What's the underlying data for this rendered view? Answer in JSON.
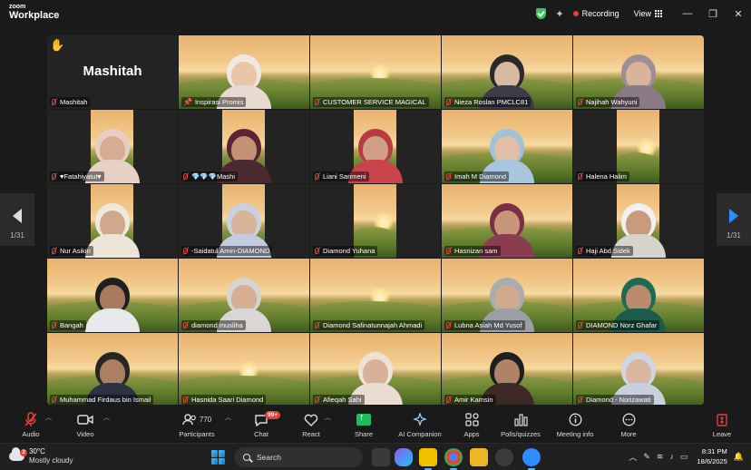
{
  "window": {
    "logo_line1": "zoom",
    "logo_line2": "Workplace",
    "recording": "Recording",
    "view": "View"
  },
  "nav": {
    "left_page": "1/31",
    "right_page": "1/31"
  },
  "tiles": [
    {
      "name": "Mashitah",
      "type": "avatar",
      "big_name": "Mashitah",
      "hand": true,
      "muted": true
    },
    {
      "name": "Inspirasi Promis",
      "type": "cam",
      "pinned": true,
      "selected": true,
      "muted": false,
      "skin": "#e9c6a8",
      "cloth": "#e7d9cf",
      "hijab": "#f1e6e0"
    },
    {
      "name": "CUSTOMER SERVICE MAGICAL",
      "type": "bg",
      "muted": true
    },
    {
      "name": "Nieza Roslan PMCLC81",
      "type": "cam",
      "muted": true,
      "skin": "#d9b8a0",
      "cloth": "#3b3b4a",
      "hijab": "#2a2a2a"
    },
    {
      "name": "Najihah Wahyuni",
      "type": "cam",
      "muted": true,
      "skin": "#d8b49a",
      "cloth": "#8a7a86",
      "hijab": "#9c8d98"
    },
    {
      "name": "♥Fatahiyatul♥",
      "type": "small",
      "muted": true,
      "skin": "#d6ad92",
      "cloth": "#e7d1c7",
      "hijab": "#e8cfc4"
    },
    {
      "name": "💎💎💎Mashi",
      "type": "small",
      "muted": true,
      "skin": "#c49273",
      "cloth": "#4a2a2e",
      "hijab": "#5a2433"
    },
    {
      "name": "Liani Sarimeni",
      "type": "small",
      "muted": true,
      "skin": "#cf9f86",
      "cloth": "#c9434b",
      "hijab": "#b83a44"
    },
    {
      "name": "Imah M Diamond",
      "type": "cam",
      "muted": true,
      "skin": "#e0bfa6",
      "cloth": "#a9c7dc",
      "hijab": "#9fc2da"
    },
    {
      "name": "Halena Halim",
      "type": "small",
      "muted": true,
      "skin": "",
      "cloth": "",
      "hijab": ""
    },
    {
      "name": "Nur Asikin",
      "type": "small",
      "muted": true,
      "skin": "#d2a88d",
      "cloth": "#ece5d7",
      "hijab": "#efe8dc"
    },
    {
      "name": "-Saidatul Amin-DIAMOND",
      "type": "small",
      "muted": true,
      "skin": "#d9b39a",
      "cloth": "#c3cbe0",
      "hijab": "#c8d0e2"
    },
    {
      "name": "Diamond Yuhana",
      "type": "small",
      "muted": true,
      "skin": "",
      "cloth": "",
      "hijab": ""
    },
    {
      "name": "Hasnizan sam",
      "type": "cam",
      "muted": true,
      "skin": "#c8967a",
      "cloth": "#8a3d4f",
      "hijab": "#7a2f44"
    },
    {
      "name": "Haji Abd Sidek",
      "type": "small",
      "muted": true,
      "skin": "#c99a7e",
      "cloth": "#d7d4cc",
      "hijab": "#f0f0f0"
    },
    {
      "name": "Bangah",
      "type": "cam",
      "muted": true,
      "skin": "#a97a5e",
      "cloth": "#e6e8ec",
      "hijab": "#1f1f1f"
    },
    {
      "name": "diamond musliha",
      "type": "cam",
      "muted": true,
      "skin": "#d5ae94",
      "cloth": "#d9d7d5",
      "hijab": "#d7d4d0"
    },
    {
      "name": "Diamond Safinatunnajah Ahmadi",
      "type": "bg",
      "muted": true
    },
    {
      "name": "Lubna Asiah Md Yusof",
      "type": "cam",
      "muted": true,
      "skin": "#d0a98e",
      "cloth": "#9aa0a6",
      "hijab": "#a7acb0"
    },
    {
      "name": "DIAMOND Norz Ghafar",
      "type": "cam",
      "muted": true,
      "skin": "#b98a6c",
      "cloth": "#1d5b4a",
      "hijab": "#1f6a56"
    },
    {
      "name": "Muhammad Firdaus bin Ismail",
      "type": "cam",
      "muted": true,
      "skin": "#ad7f62",
      "cloth": "#2c3240",
      "hijab": "#262626"
    },
    {
      "name": "Hasnida Saari Diamond",
      "type": "bg",
      "muted": true
    },
    {
      "name": "Afieqah Sahi",
      "type": "cam",
      "muted": true,
      "skin": "#d8b19a",
      "cloth": "#eadcd0",
      "hijab": "#eee2d6"
    },
    {
      "name": "Amir Kamsin",
      "type": "cam",
      "muted": true,
      "skin": "#b08266",
      "cloth": "#3d2a26",
      "hijab": "#1e1e1e"
    },
    {
      "name": "Diamond - Norizawati",
      "type": "cam",
      "muted": true,
      "skin": "#d9b79e",
      "cloth": "#c7d0dc",
      "hijab": "#cdd6e2"
    }
  ],
  "toolbar": {
    "audio": "Audio",
    "video": "Video",
    "participants": "Participants",
    "participants_count": "770",
    "chat": "Chat",
    "chat_badge": "99+",
    "react": "React",
    "share": "Share",
    "ai": "AI Companion",
    "apps": "Apps",
    "polls": "Polls/quizzes",
    "meeting_info": "Meeting info",
    "more": "More",
    "leave": "Leave"
  },
  "taskbar": {
    "weather_badge": "2",
    "temp": "30°C",
    "condition": "Mostly cloudy",
    "search": "Search",
    "time": "8:31 PM",
    "date": "18/6/2025"
  },
  "colors": {
    "accent_green": "#2bd46b",
    "mute_red": "#e0413b",
    "nav_blue": "#2d8cff"
  }
}
